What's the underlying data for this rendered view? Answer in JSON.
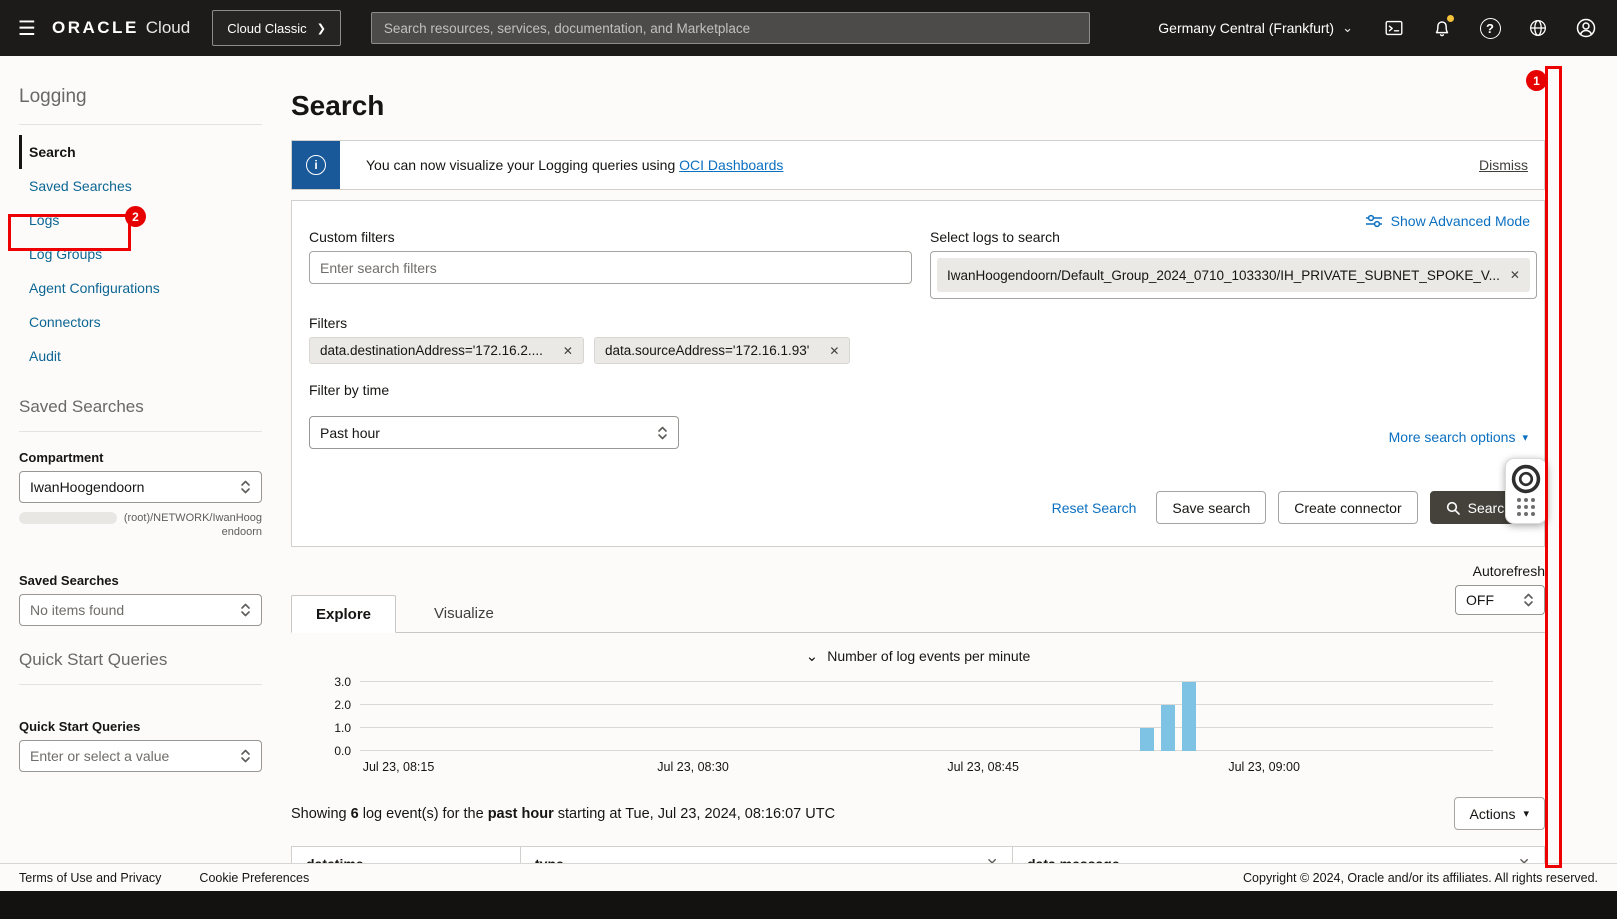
{
  "icons": {
    "hamburger": "☰",
    "chevron_right": "❯",
    "chevron_down": "⌄",
    "caret_down": "▾",
    "question": "?",
    "info": "i",
    "close": "✕",
    "collapse": "⌄"
  },
  "header": {
    "logo_primary": "ORACLE",
    "logo_secondary": "Cloud",
    "cloud_classic_label": "Cloud Classic",
    "search_placeholder": "Search resources, services, documentation, and Marketplace",
    "region_label": "Germany Central (Frankfurt)"
  },
  "sidebar": {
    "title": "Logging",
    "nav": [
      {
        "label": "Search"
      },
      {
        "label": "Saved Searches"
      },
      {
        "label": "Logs"
      },
      {
        "label": "Log Groups"
      },
      {
        "label": "Agent Configurations"
      },
      {
        "label": "Connectors"
      },
      {
        "label": "Audit"
      }
    ],
    "saved_searches_heading": "Saved Searches",
    "compartment_label": "Compartment",
    "compartment_value": "IwanHoogendoorn",
    "compartment_path": "(root)/NETWORK/IwanHoogendoorn",
    "saved_searches_label": "Saved Searches",
    "saved_searches_value": "No items found",
    "quick_start_heading": "Quick Start Queries",
    "quick_start_label": "Quick Start Queries",
    "quick_start_placeholder": "Enter or select a value"
  },
  "main": {
    "page_title": "Search",
    "banner": {
      "text": "You can now visualize your Logging queries using ",
      "link_label": "OCI Dashboards",
      "dismiss_label": "Dismiss"
    },
    "panel": {
      "advanced_mode_label": "Show Advanced Mode",
      "custom_filters_label": "Custom filters",
      "custom_filters_placeholder": "Enter search filters",
      "select_logs_label": "Select logs to search",
      "selected_log": "IwanHoogendoorn/Default_Group_2024_0710_103330/IH_PRIVATE_SUBNET_SPOKE_V...",
      "filters_label": "Filters",
      "filter_chips": [
        {
          "label": "data.destinationAddress='172.16.2...."
        },
        {
          "label": "data.sourceAddress='172.16.1.93'"
        }
      ],
      "filter_by_time_label": "Filter by time",
      "time_value": "Past hour",
      "more_options_label": "More search options",
      "reset_label": "Reset Search",
      "save_search_label": "Save search",
      "create_connector_label": "Create connector",
      "search_label": "Search"
    },
    "autorefresh_label": "Autorefresh",
    "autorefresh_value": "OFF",
    "tabs": [
      {
        "label": "Explore"
      },
      {
        "label": "Visualize"
      }
    ],
    "summary": {
      "p1": "Showing ",
      "b1": "6",
      "p2": " log event(s) for the ",
      "b2": "past hour",
      "p3": " starting at Tue, Jul 23, 2024, 08:16:07 UTC"
    },
    "actions_label": "Actions",
    "table": {
      "columns": [
        {
          "label": "datetime"
        },
        {
          "label": "type"
        },
        {
          "label": "data.message"
        }
      ]
    }
  },
  "chart_data": {
    "type": "bar",
    "title": "Number of log events per minute",
    "ylim": [
      0,
      3
    ],
    "grid": true,
    "legend": false,
    "bar_color": "#7ec2e4",
    "y_ticks": [
      {
        "label": "0.0",
        "value": 0
      },
      {
        "label": "1.0",
        "value": 1
      },
      {
        "label": "2.0",
        "value": 2
      },
      {
        "label": "3.0",
        "value": 3
      }
    ],
    "x_ticks": [
      {
        "label": "Jul 23, 08:15",
        "frac": 0.034
      },
      {
        "label": "Jul 23, 08:30",
        "frac": 0.294
      },
      {
        "label": "Jul 23, 08:45",
        "frac": 0.55
      },
      {
        "label": "Jul 23, 09:00",
        "frac": 0.798
      }
    ],
    "bars": [
      {
        "frac": 0.695,
        "value": 1
      },
      {
        "frac": 0.7135,
        "value": 2
      },
      {
        "frac": 0.732,
        "value": 3
      }
    ]
  },
  "footer": {
    "terms_label": "Terms of Use and Privacy",
    "cookie_label": "Cookie Preferences",
    "copyright": "Copyright © 2024, Oracle and/or its affiliates. All rights reserved."
  },
  "annotations": {
    "step1": "1",
    "step2": "2"
  }
}
